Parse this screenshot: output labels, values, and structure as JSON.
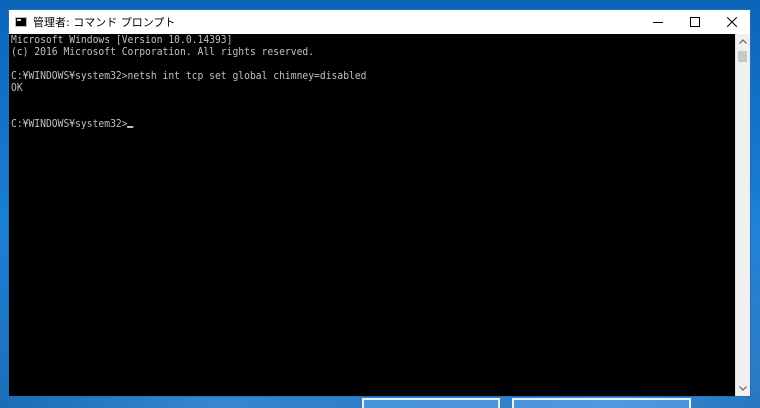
{
  "window": {
    "title": "管理者: コマンド プロンプト"
  },
  "console": {
    "lines": [
      "Microsoft Windows [Version 10.0.14393]",
      "(c) 2016 Microsoft Corporation. All rights reserved.",
      "",
      "C:¥WINDOWS¥system32>netsh int tcp set global chimney=disabled",
      "OK",
      "",
      "",
      "C:¥WINDOWS¥system32>"
    ]
  },
  "icons": {
    "app": "console-app-icon",
    "minimize": "minimize-icon",
    "maximize": "maximize-icon",
    "close": "close-icon",
    "scroll_up": "scroll-up-arrow-icon",
    "scroll_down": "scroll-down-arrow-icon"
  },
  "colors": {
    "console_background": "#000000",
    "console_text": "#c0c0c0",
    "titlebar": "#ffffff",
    "window_border": "#1e6fc2"
  }
}
